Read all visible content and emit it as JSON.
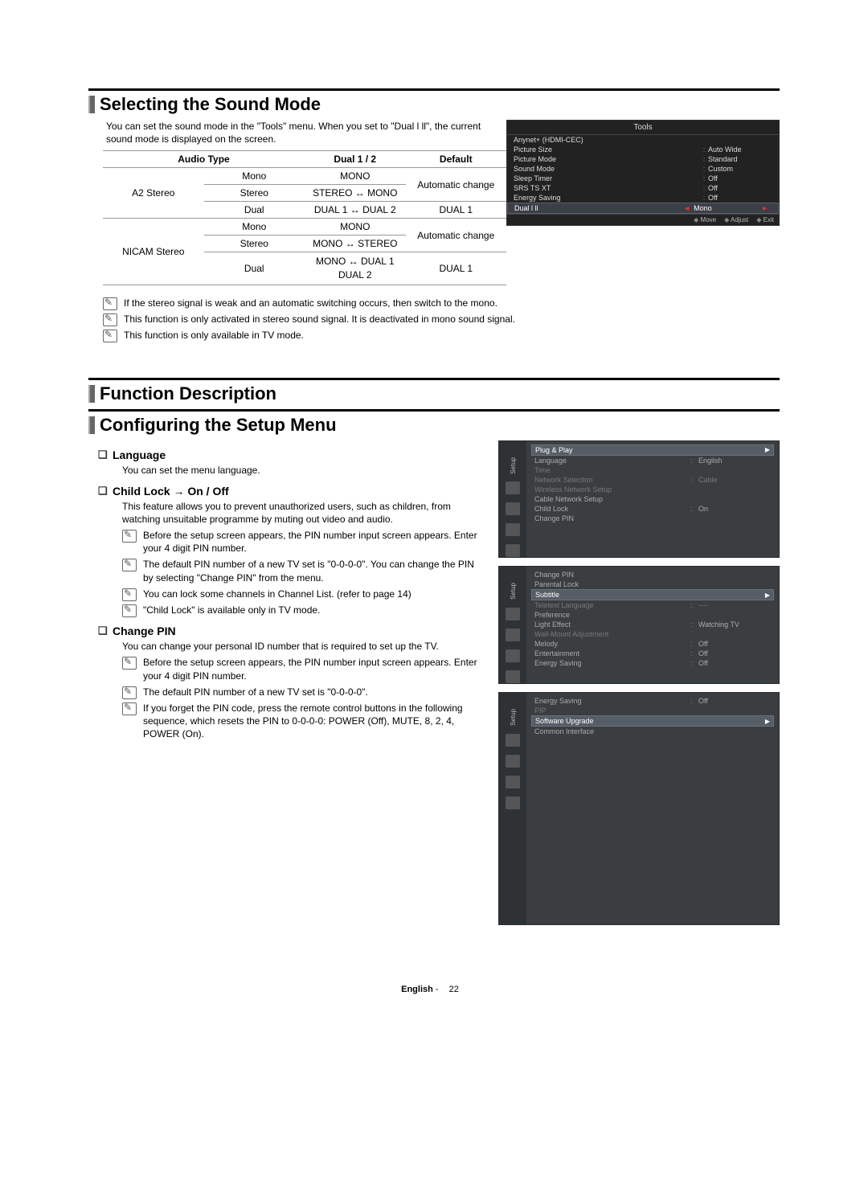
{
  "section1": {
    "title": "Selecting the Sound Mode",
    "intro": "You can set the sound mode in the \"Tools\" menu. When you set to \"Dual l ll\", the current sound mode is displayed on the screen.",
    "table": {
      "headers": [
        "Audio Type",
        "Dual 1 / 2",
        "Default"
      ],
      "a2_label": "A2 Stereo",
      "a2_rows": [
        {
          "c1": "Mono",
          "c2": "MONO",
          "c3": "Automatic change"
        },
        {
          "c1": "Stereo",
          "c2": "STEREO ↔ MONO",
          "c3": ""
        },
        {
          "c1": "Dual",
          "c2": "DUAL 1 ↔ DUAL 2",
          "c3": "DUAL 1"
        }
      ],
      "nicam_label": "NICAM Stereo",
      "nicam_rows": [
        {
          "c1": "Mono",
          "c2": "MONO",
          "c3": "Automatic change"
        },
        {
          "c1": "Stereo",
          "c2": "MONO ↔ STEREO",
          "c3": ""
        },
        {
          "c1": "Dual",
          "c2": "MONO ↔ DUAL 1  DUAL 2",
          "c3": "DUAL 1"
        }
      ]
    },
    "notes": [
      "If the stereo signal is weak and an automatic switching occurs, then switch to the mono.",
      "This function is only activated in stereo sound signal. It is deactivated in mono sound signal.",
      "This function is only available in TV mode."
    ]
  },
  "tools_osd": {
    "title": "Tools",
    "rows": [
      {
        "k": "Anynet+ (HDMI-CEC)",
        "v": ""
      },
      {
        "k": "Picture Size",
        "v": "Auto Wide"
      },
      {
        "k": "Picture Mode",
        "v": "Standard"
      },
      {
        "k": "Sound Mode",
        "v": "Custom"
      },
      {
        "k": "Sleep Timer",
        "v": "Off"
      },
      {
        "k": "SRS TS XT",
        "v": "Off"
      },
      {
        "k": "Energy Saving",
        "v": "Off"
      },
      {
        "k": "Dual l ll",
        "v": "Mono",
        "hi": true
      }
    ],
    "footer": [
      "Move",
      "Adjust",
      "Exit"
    ]
  },
  "section2": {
    "title": "Function Description"
  },
  "section3": {
    "title": "Configuring the Setup Menu",
    "items": [
      {
        "head": "Language",
        "desc": "You can set the menu language.",
        "notes": []
      },
      {
        "head": "Child Lock → On / Off",
        "desc": "This feature allows you to prevent unauthorized users, such as children, from watching unsuitable programme by muting out video and audio.",
        "notes": [
          "Before the setup screen appears, the PIN number input screen appears. Enter your 4 digit PIN number.",
          "The default PIN number of a new TV set is \"0-0-0-0\". You can change the PIN by selecting \"Change PIN\" from the menu.",
          "You can lock some channels in Channel List. (refer to page 14)",
          "\"Child Lock\" is available only in TV mode."
        ]
      },
      {
        "head": "Change PIN",
        "desc": "You can change your personal ID number that is required to set up the TV.",
        "notes": [
          "Before the setup screen appears, the PIN number input screen appears. Enter your 4 digit PIN number.",
          "The default PIN number of a new TV set is \"0-0-0-0\".",
          "If you forget the PIN code, press the remote control buttons in the following sequence, which resets the PIN to 0-0-0-0: POWER (Off), MUTE, 8, 2, 4, POWER (On)."
        ]
      }
    ]
  },
  "setup_panels": [
    {
      "side": "Setup",
      "rows": [
        {
          "k": "Plug & Play",
          "sel": true
        },
        {
          "k": "Language",
          "v": "English"
        },
        {
          "k": "Time",
          "dim": true
        },
        {
          "k": "Network Selection",
          "v": "Cable",
          "dim": true
        },
        {
          "k": "Wireless Network Setup",
          "dim": true
        },
        {
          "k": "Cable Network Setup"
        },
        {
          "k": "Child Lock",
          "v": "On"
        },
        {
          "k": "Change PIN"
        }
      ]
    },
    {
      "side": "Setup",
      "rows": [
        {
          "k": "Change PIN"
        },
        {
          "k": "Parental Lock"
        },
        {
          "k": "Subtitle",
          "sel": true
        },
        {
          "k": "Teletext Language",
          "v": "----",
          "dim": true
        },
        {
          "k": "Preference"
        },
        {
          "k": "Light Effect",
          "v": "Watching TV"
        },
        {
          "k": "Wall-Mount Adjustment",
          "dim": true
        },
        {
          "k": "Melody",
          "v": "Off"
        },
        {
          "k": "Entertainment",
          "v": "Off"
        },
        {
          "k": "Energy Saving",
          "v": "Off"
        }
      ]
    },
    {
      "side": "Setup",
      "tall": true,
      "rows": [
        {
          "k": "Energy Saving",
          "v": "Off"
        },
        {
          "k": "PIP",
          "dim": true
        },
        {
          "k": "Software Upgrade",
          "sel": true
        },
        {
          "k": "Common Interface"
        }
      ]
    }
  ],
  "footer": {
    "lang": "English",
    "page": "22"
  }
}
